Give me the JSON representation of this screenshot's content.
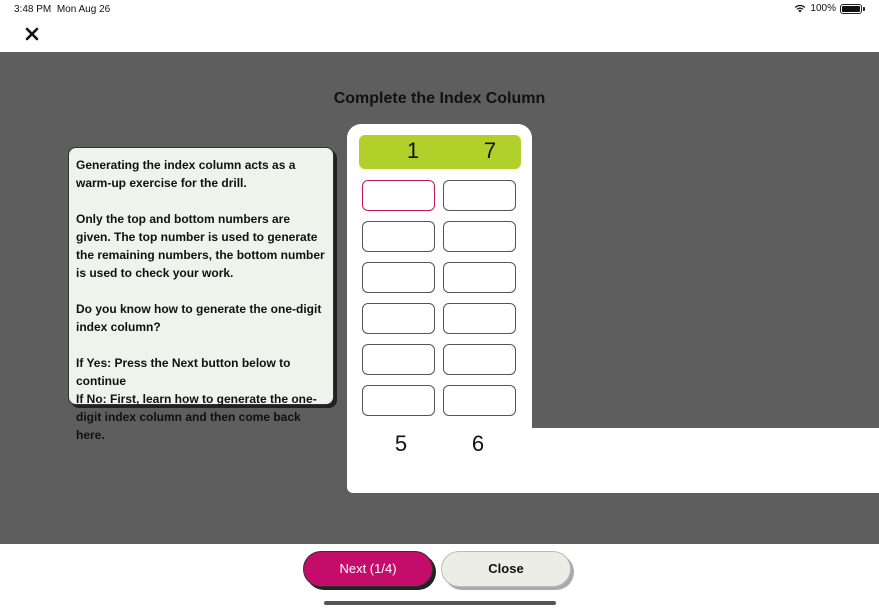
{
  "status_bar": {
    "time": "3:48 PM",
    "date": "Mon Aug 26",
    "battery_percent": "100%",
    "battery_level": 1.0
  },
  "header": {
    "close_icon": "close-icon"
  },
  "main": {
    "title": "Complete the Index Column",
    "info_paragraphs": [
      "Generating the index column acts as a warm-up exercise for the drill.",
      "Only the top and bottom numbers are given. The top number is used to generate the remaining numbers, the bottom number is used to check your work.",
      "Do you know how to generate the one-digit index column?",
      "If Yes: Press the Next button below to continue\nIf No: First, learn how to generate the one-digit index column and then come back here."
    ],
    "top_numbers": [
      "1",
      "7"
    ],
    "bottom_numbers": [
      "5",
      "6"
    ],
    "input_rows": 6,
    "colors": {
      "number_bar": "#b1d12a",
      "active_cell_border": "#c2185b",
      "backdrop": "#5e5e5e"
    }
  },
  "footer": {
    "next_label": "Next (1/4)",
    "close_label": "Close",
    "next_color": "#c40c6b"
  }
}
